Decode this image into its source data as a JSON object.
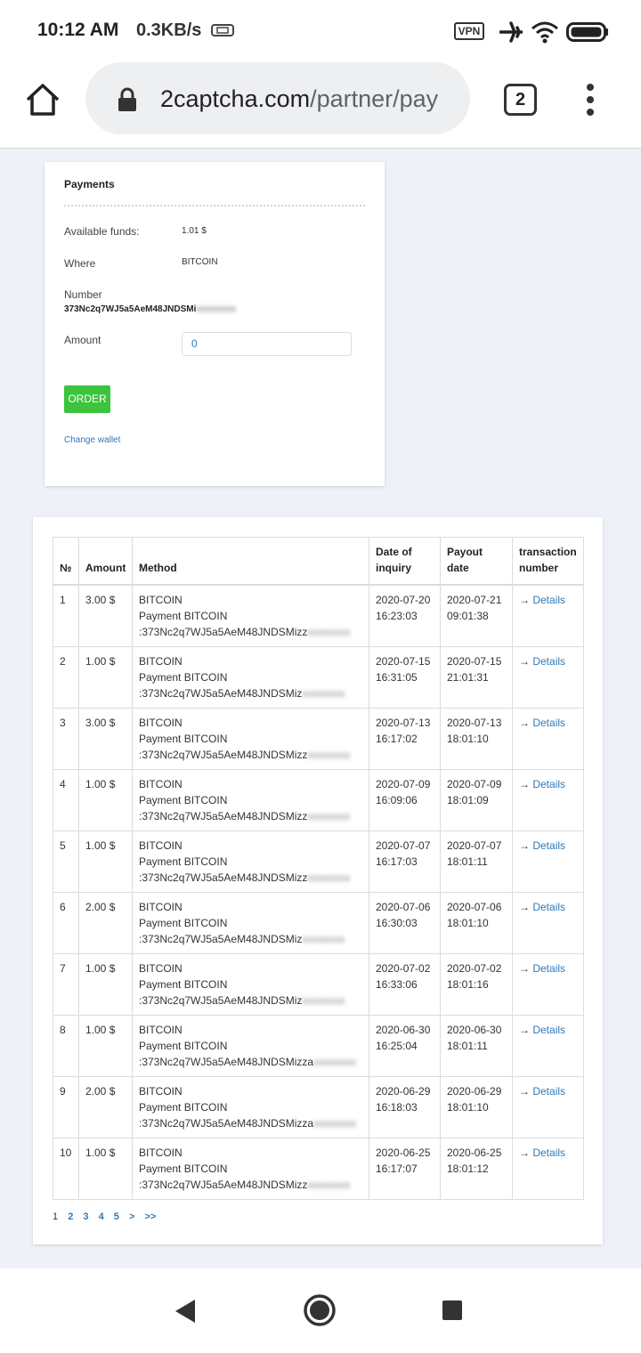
{
  "status": {
    "time": "10:12 AM",
    "speed": "0.3KB/s",
    "vpn": "VPN"
  },
  "browser": {
    "url_domain": "2captcha.com",
    "url_path": "/partner/pay",
    "tab_count": "2"
  },
  "payments": {
    "title": "Payments",
    "available_label": "Available funds:",
    "available_value": "1.01 $",
    "where_label": "Where",
    "where_value": "BITCOIN",
    "number_label": "Number",
    "number_value": "373Nc2q7WJ5a5AeM48JNDSMi",
    "amount_label": "Amount",
    "amount_value": "0",
    "order_label": "ORDER",
    "change_wallet_label": "Change wallet"
  },
  "history": {
    "headers": [
      "№",
      "Amount",
      "Method",
      "Date of inquiry",
      "Payout date",
      "transaction number"
    ],
    "rows": [
      {
        "n": "1",
        "amount": "3.00 $",
        "m1": "BITCOIN",
        "m2": "Payment BITCOIN",
        "m3": ":373Nc2q7WJ5a5AeM48JNDSMizz",
        "d1": "2020-07-20",
        "t1": "16:23:03",
        "d2": "2020-07-21",
        "t2": "09:01:38",
        "details": "Details"
      },
      {
        "n": "2",
        "amount": "1.00 $",
        "m1": "BITCOIN",
        "m2": "Payment BITCOIN",
        "m3": ":373Nc2q7WJ5a5AeM48JNDSMiz",
        "d1": "2020-07-15",
        "t1": "16:31:05",
        "d2": "2020-07-15",
        "t2": "21:01:31",
        "details": "Details"
      },
      {
        "n": "3",
        "amount": "3.00 $",
        "m1": "BITCOIN",
        "m2": "Payment BITCOIN",
        "m3": ":373Nc2q7WJ5a5AeM48JNDSMizz",
        "d1": "2020-07-13",
        "t1": "16:17:02",
        "d2": "2020-07-13",
        "t2": "18:01:10",
        "details": "Details"
      },
      {
        "n": "4",
        "amount": "1.00 $",
        "m1": "BITCOIN",
        "m2": "Payment BITCOIN",
        "m3": ":373Nc2q7WJ5a5AeM48JNDSMizz",
        "d1": "2020-07-09",
        "t1": "16:09:06",
        "d2": "2020-07-09",
        "t2": "18:01:09",
        "details": "Details"
      },
      {
        "n": "5",
        "amount": "1.00 $",
        "m1": "BITCOIN",
        "m2": "Payment BITCOIN",
        "m3": ":373Nc2q7WJ5a5AeM48JNDSMizz",
        "d1": "2020-07-07",
        "t1": "16:17:03",
        "d2": "2020-07-07",
        "t2": "18:01:11",
        "details": "Details"
      },
      {
        "n": "6",
        "amount": "2.00 $",
        "m1": "BITCOIN",
        "m2": "Payment BITCOIN",
        "m3": ":373Nc2q7WJ5a5AeM48JNDSMiz",
        "d1": "2020-07-06",
        "t1": "16:30:03",
        "d2": "2020-07-06",
        "t2": "18:01:10",
        "details": "Details"
      },
      {
        "n": "7",
        "amount": "1.00 $",
        "m1": "BITCOIN",
        "m2": "Payment BITCOIN",
        "m3": ":373Nc2q7WJ5a5AeM48JNDSMiz",
        "d1": "2020-07-02",
        "t1": "16:33:06",
        "d2": "2020-07-02",
        "t2": "18:01:16",
        "details": "Details"
      },
      {
        "n": "8",
        "amount": "1.00 $",
        "m1": "BITCOIN",
        "m2": "Payment BITCOIN",
        "m3": ":373Nc2q7WJ5a5AeM48JNDSMizza",
        "d1": "2020-06-30",
        "t1": "16:25:04",
        "d2": "2020-06-30",
        "t2": "18:01:11",
        "details": "Details"
      },
      {
        "n": "9",
        "amount": "2.00 $",
        "m1": "BITCOIN",
        "m2": "Payment BITCOIN",
        "m3": ":373Nc2q7WJ5a5AeM48JNDSMizza",
        "d1": "2020-06-29",
        "t1": "16:18:03",
        "d2": "2020-06-29",
        "t2": "18:01:10",
        "details": "Details"
      },
      {
        "n": "10",
        "amount": "1.00 $",
        "m1": "BITCOIN",
        "m2": "Payment BITCOIN",
        "m3": ":373Nc2q7WJ5a5AeM48JNDSMizz",
        "d1": "2020-06-25",
        "t1": "16:17:07",
        "d2": "2020-06-25",
        "t2": "18:01:12",
        "details": "Details"
      }
    ]
  },
  "pagination": [
    "1",
    "2",
    "3",
    "4",
    "5",
    ">",
    ">>"
  ]
}
